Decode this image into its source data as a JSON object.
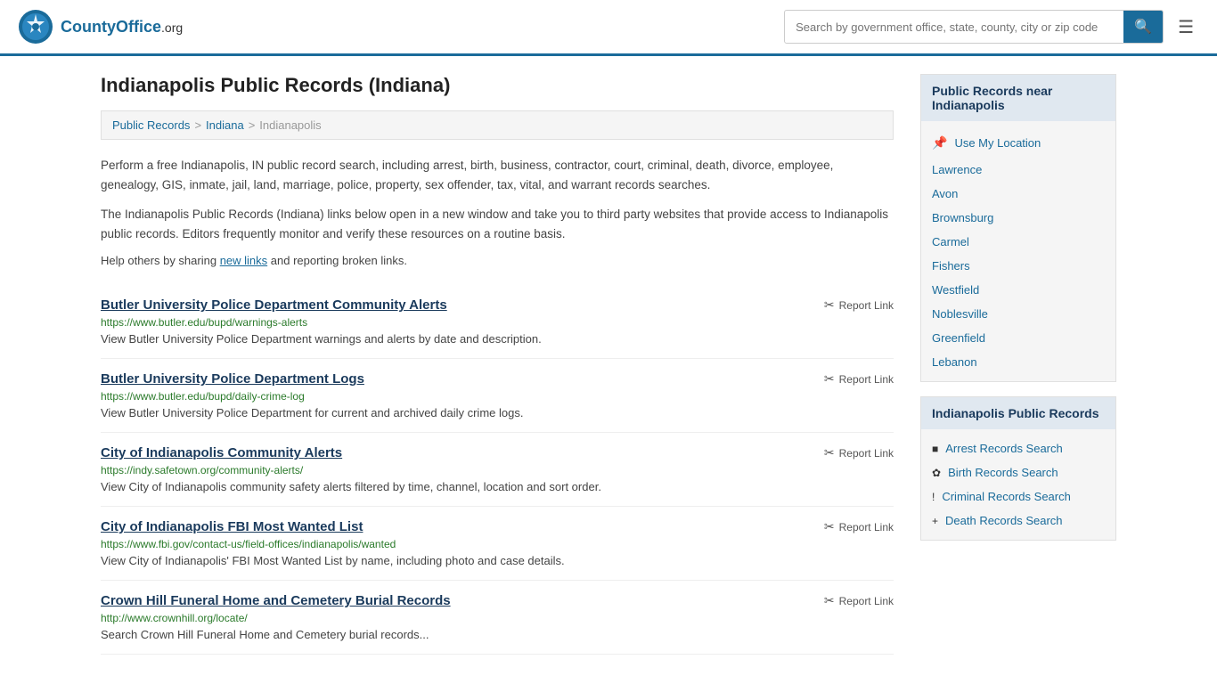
{
  "header": {
    "logo_text": "CountyOffice",
    "logo_suffix": ".org",
    "search_placeholder": "Search by government office, state, county, city or zip code",
    "search_button_label": "Search",
    "menu_button_label": "Menu"
  },
  "page": {
    "title": "Indianapolis Public Records (Indiana)",
    "breadcrumb": {
      "items": [
        "Public Records",
        "Indiana",
        "Indianapolis"
      ]
    },
    "intro1": "Perform a free Indianapolis, IN public record search, including arrest, birth, business, contractor, court, criminal, death, divorce, employee, genealogy, GIS, inmate, jail, land, marriage, police, property, sex offender, tax, vital, and warrant records searches.",
    "intro2": "The Indianapolis Public Records (Indiana) links below open in a new window and take you to third party websites that provide access to Indianapolis public records. Editors frequently monitor and verify these resources on a routine basis.",
    "help_text_prefix": "Help others by sharing ",
    "help_link": "new links",
    "help_text_suffix": " and reporting broken links."
  },
  "records": [
    {
      "title": "Butler University Police Department Community Alerts",
      "url": "https://www.butler.edu/bupd/warnings-alerts",
      "description": "View Butler University Police Department warnings and alerts by date and description.",
      "report_label": "Report Link"
    },
    {
      "title": "Butler University Police Department Logs",
      "url": "https://www.butler.edu/bupd/daily-crime-log",
      "description": "View Butler University Police Department for current and archived daily crime logs.",
      "report_label": "Report Link"
    },
    {
      "title": "City of Indianapolis Community Alerts",
      "url": "https://indy.safetown.org/community-alerts/",
      "description": "View City of Indianapolis community safety alerts filtered by time, channel, location and sort order.",
      "report_label": "Report Link"
    },
    {
      "title": "City of Indianapolis FBI Most Wanted List",
      "url": "https://www.fbi.gov/contact-us/field-offices/indianapolis/wanted",
      "description": "View City of Indianapolis' FBI Most Wanted List by name, including photo and case details.",
      "report_label": "Report Link"
    },
    {
      "title": "Crown Hill Funeral Home and Cemetery Burial Records",
      "url": "http://www.crownhill.org/locate/",
      "description": "Search Crown Hill Funeral Home and Cemetery burial records...",
      "report_label": "Report Link"
    }
  ],
  "sidebar": {
    "nearby_section": {
      "title": "Public Records near Indianapolis",
      "use_my_location": "Use My Location",
      "links": [
        "Lawrence",
        "Avon",
        "Brownsburg",
        "Carmel",
        "Fishers",
        "Westfield",
        "Noblesville",
        "Greenfield",
        "Lebanon"
      ]
    },
    "public_records_section": {
      "title": "Indianapolis Public Records",
      "items": [
        {
          "label": "Arrest Records Search",
          "icon": "■"
        },
        {
          "label": "Birth Records Search",
          "icon": "✿"
        },
        {
          "label": "Criminal Records Search",
          "icon": "!"
        },
        {
          "label": "Death Records Search",
          "icon": "+"
        }
      ]
    }
  }
}
